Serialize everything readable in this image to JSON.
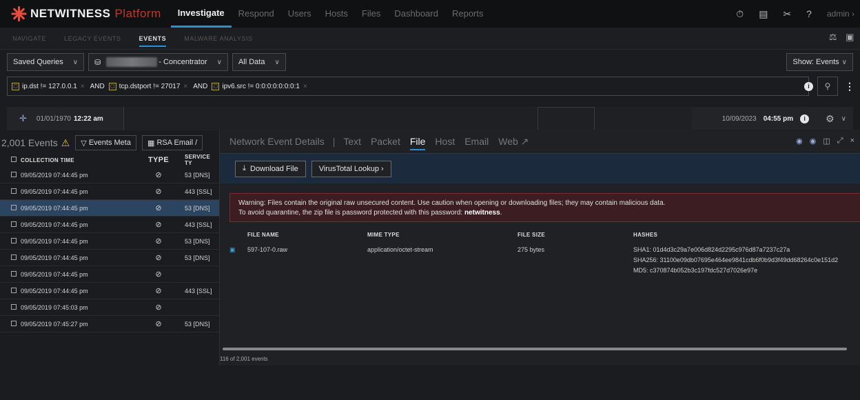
{
  "app": {
    "name": "NETWITNESS",
    "platform": "Platform"
  },
  "topnav": {
    "items": [
      "Investigate",
      "Respond",
      "Users",
      "Hosts",
      "Files",
      "Dashboard",
      "Reports"
    ],
    "active": "Investigate",
    "user": "admin"
  },
  "subnav": {
    "items": [
      "NAVIGATE",
      "LEGACY EVENTS",
      "EVENTS",
      "MALWARE ANALYSIS"
    ],
    "active": "EVENTS"
  },
  "query": {
    "saved_queries": "Saved Queries",
    "source": "- Concentrator",
    "range": "All Data",
    "show": "Show: Events"
  },
  "filters": [
    {
      "label": "ip.dst != 127.0.0.1"
    },
    {
      "label": "tcp.dstport != 27017"
    },
    {
      "label": "ipv6.src != 0:0:0:0:0:0:0:1"
    }
  ],
  "and_label": "AND",
  "time": {
    "start_date": "01/01/1970",
    "start_time": "12:22 am",
    "end_date": "10/09/2023",
    "end_time": "04:55 pm"
  },
  "events": {
    "count": "2,001 Events",
    "meta_button": "Events Meta",
    "email_button": "RSA Email /",
    "columns": [
      "COLLECTION TIME",
      "TYPE",
      "SERVICE TY"
    ],
    "rows": [
      {
        "time": "09/05/2019 07:44:45 pm",
        "service": "53 [DNS]"
      },
      {
        "time": "09/05/2019 07:44:45 pm",
        "service": "443 [SSL]"
      },
      {
        "time": "09/05/2019 07:44:45 pm",
        "service": "53 [DNS]"
      },
      {
        "time": "09/05/2019 07:44:45 pm",
        "service": "443 [SSL]"
      },
      {
        "time": "09/05/2019 07:44:45 pm",
        "service": "53 [DNS]"
      },
      {
        "time": "09/05/2019 07:44:45 pm",
        "service": "53 [DNS]"
      },
      {
        "time": "09/05/2019 07:44:45 pm",
        "service": ""
      },
      {
        "time": "09/05/2019 07:44:45 pm",
        "service": "443 [SSL]"
      },
      {
        "time": "09/05/2019 07:45:03 pm",
        "service": ""
      },
      {
        "time": "09/05/2019 07:45:27 pm",
        "service": "53 [DNS]"
      }
    ],
    "selected_index": 2,
    "footer": "116 of 2,001 events"
  },
  "detail": {
    "tabs": [
      "Network Event Details",
      "Text",
      "Packet",
      "File",
      "Host",
      "Email",
      "Web"
    ],
    "active": "File",
    "download": "Download File",
    "virustotal": "VirusTotal Lookup",
    "warning_line1": "Warning: Files contain the original raw unsecured content. Use caution when opening or downloading files; they may contain malicious data.",
    "warning_line2_prefix": "To avoid quarantine, the zip file is password protected with this password: ",
    "warning_password": "netwitness",
    "columns": [
      "FILE NAME",
      "MIME TYPE",
      "FILE SIZE",
      "HASHES"
    ],
    "file": {
      "name": "597-107-0.raw",
      "mime": "application/octet-stream",
      "size": "275 bytes",
      "sha1": "SHA1: 01d4d3c29a7e006d824d2295c976d87a7237c27a",
      "sha256": "SHA256: 31100e09db07695e464ee9841cdb6f0b9d3f49dd68264c0e151d2",
      "md5": "MD5: c370874b052b3c197fdc527d7026e97e"
    }
  },
  "colors": {
    "accent": "#2b8fd6",
    "brand_red": "#c0392b",
    "warning_bg": "#3b1d22",
    "selected_row": "#2b4460"
  }
}
